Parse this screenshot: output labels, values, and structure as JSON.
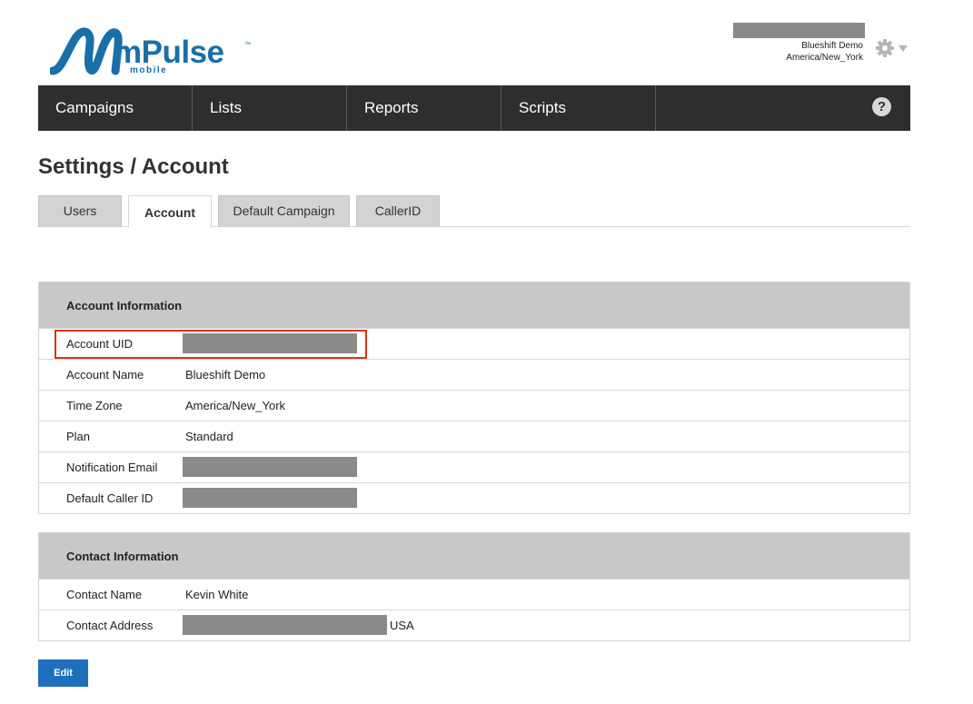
{
  "brand": {
    "name": "mPulse",
    "trademark": "™",
    "subtitle": "mobile",
    "color": "#1a6fa8"
  },
  "user": {
    "account": "Blueshift Demo",
    "timezone": "America/New_York"
  },
  "nav": {
    "items": [
      {
        "label": "Campaigns"
      },
      {
        "label": "Lists"
      },
      {
        "label": "Reports"
      },
      {
        "label": "Scripts"
      }
    ],
    "help_label": "?"
  },
  "page": {
    "title": "Settings / Account"
  },
  "tabs": [
    {
      "label": "Users",
      "active": false
    },
    {
      "label": "Account",
      "active": true
    },
    {
      "label": "Default Campaign",
      "active": false
    },
    {
      "label": "CallerID",
      "active": false
    }
  ],
  "account_info": {
    "heading": "Account Information",
    "rows": [
      {
        "label": "Account UID",
        "value": "",
        "redacted": true,
        "highlighted": true
      },
      {
        "label": "Account Name",
        "value": "Blueshift Demo"
      },
      {
        "label": "Time Zone",
        "value": "America/New_York"
      },
      {
        "label": "Plan",
        "value": "Standard"
      },
      {
        "label": "Notification Email",
        "value": "",
        "redacted": true
      },
      {
        "label": "Default Caller ID",
        "value": "",
        "redacted": true
      }
    ]
  },
  "contact_info": {
    "heading": "Contact Information",
    "rows": [
      {
        "label": "Contact Name",
        "value": "Kevin White"
      },
      {
        "label": "Contact Address",
        "value": "",
        "redacted": true,
        "suffix": "USA"
      }
    ]
  },
  "actions": {
    "edit_label": "Edit"
  },
  "colors": {
    "nav_bg": "#2e2e2e",
    "header_bg": "#c8c8c8",
    "button_bg": "#1e6fbd",
    "highlight": "#d8321e",
    "redaction": "#8a8a8a"
  }
}
